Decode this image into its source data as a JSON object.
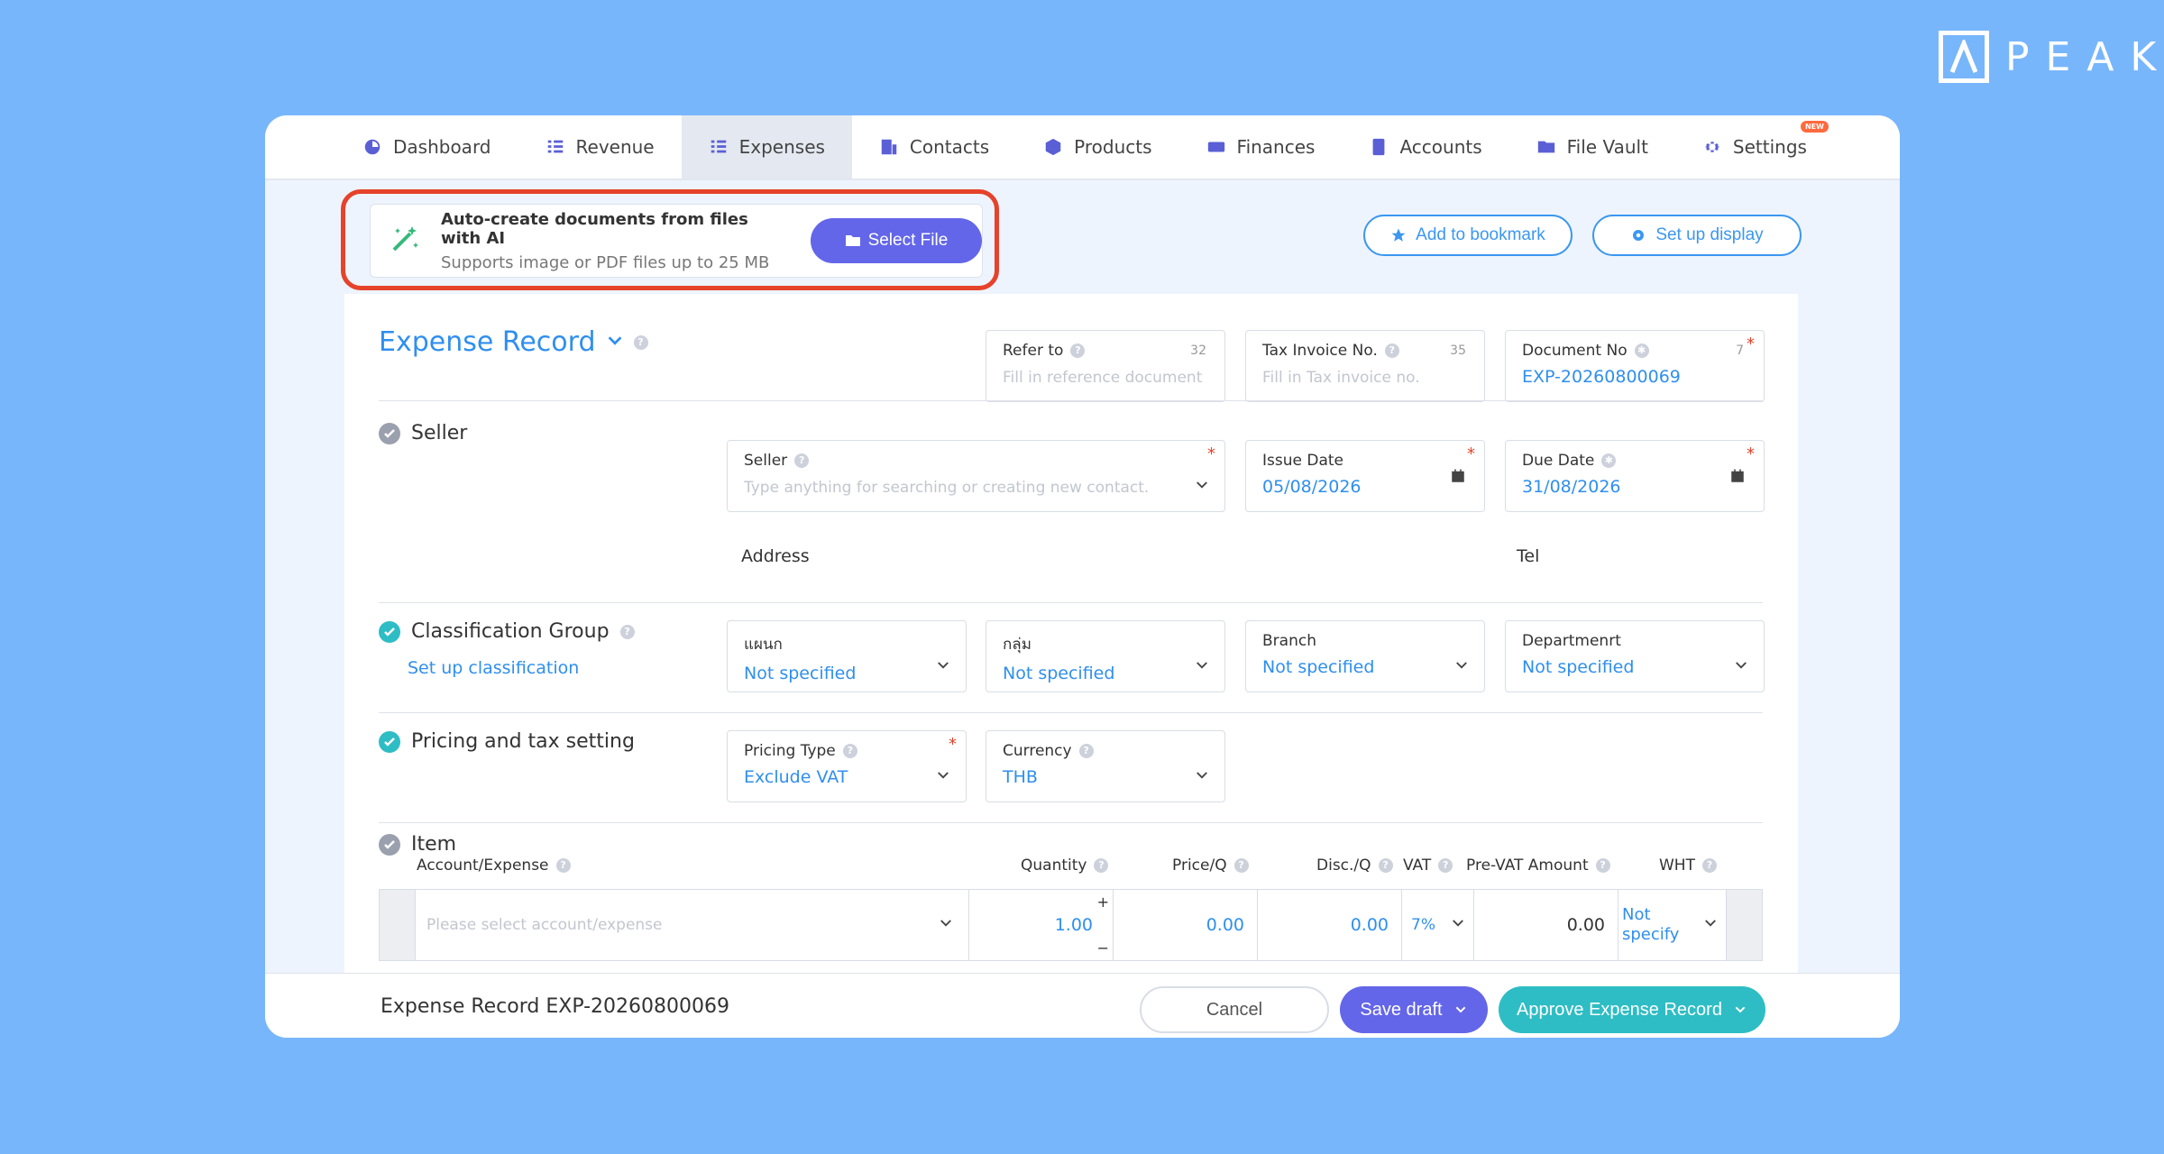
{
  "brand": {
    "name": "PEAK"
  },
  "nav": {
    "items": [
      {
        "label": "Dashboard",
        "icon": "dashboard-icon"
      },
      {
        "label": "Revenue",
        "icon": "revenue-icon"
      },
      {
        "label": "Expenses",
        "icon": "expenses-icon",
        "active": true
      },
      {
        "label": "Contacts",
        "icon": "contacts-icon"
      },
      {
        "label": "Products",
        "icon": "products-icon"
      },
      {
        "label": "Finances",
        "icon": "finances-icon"
      },
      {
        "label": "Accounts",
        "icon": "accounts-icon"
      },
      {
        "label": "File Vault",
        "icon": "folder-icon"
      },
      {
        "label": "Settings",
        "icon": "gear-icon",
        "badge": "NEW"
      }
    ]
  },
  "ai_upload": {
    "title": "Auto-create documents from files with AI",
    "subtitle": "Supports image or PDF files up to 25 MB",
    "button": "Select File"
  },
  "toolbar": {
    "bookmark": "Add to bookmark",
    "display": "Set up display"
  },
  "form": {
    "title": "Expense Record",
    "refer_to": {
      "label": "Refer to",
      "count": "32",
      "placeholder": "Fill in reference document"
    },
    "tax_invoice": {
      "label": "Tax Invoice No.",
      "count": "35",
      "placeholder": "Fill in Tax invoice no."
    },
    "document_no": {
      "label": "Document No",
      "count": "7",
      "value": "EXP-20260800069"
    },
    "seller_section": "Seller",
    "seller": {
      "label": "Seller",
      "placeholder": "Type anything for searching or creating new contact."
    },
    "issue_date": {
      "label": "Issue Date",
      "value": "05/08/2026"
    },
    "due_date": {
      "label": "Due Date",
      "value": "31/08/2026"
    },
    "address_label": "Address",
    "tel_label": "Tel",
    "classification": {
      "title": "Classification Group",
      "link": "Set up classification",
      "fields": [
        {
          "label": "แผนก",
          "value": "Not specified"
        },
        {
          "label": "กลุ่ม",
          "value": "Not specified"
        },
        {
          "label": "Branch",
          "value": "Not specified"
        },
        {
          "label": "Departmenrt",
          "value": "Not specified"
        }
      ]
    },
    "pricing": {
      "title": "Pricing and tax setting",
      "pricing_type": {
        "label": "Pricing Type",
        "value": "Exclude VAT"
      },
      "currency": {
        "label": "Currency",
        "value": "THB"
      }
    },
    "item": {
      "title": "Item",
      "columns": {
        "account": "Account/Expense",
        "quantity": "Quantity",
        "price": "Price/Q",
        "discount": "Disc./Q",
        "vat": "VAT",
        "pre_vat": "Pre-VAT Amount",
        "wht": "WHT"
      },
      "row": {
        "account_placeholder": "Please select account/expense",
        "quantity": "1.00",
        "price": "0.00",
        "discount": "0.00",
        "vat": "7%",
        "pre_vat": "0.00",
        "wht": "Not specify"
      }
    }
  },
  "footer": {
    "title": "Expense Record EXP-20260800069",
    "cancel": "Cancel",
    "save_draft": "Save draft",
    "approve": "Approve Expense Record"
  },
  "colors": {
    "background": "#78b6fb",
    "primary": "#6366e8",
    "link": "#2f8fee",
    "teal": "#2ebdc4",
    "highlight": "#e5432a"
  }
}
